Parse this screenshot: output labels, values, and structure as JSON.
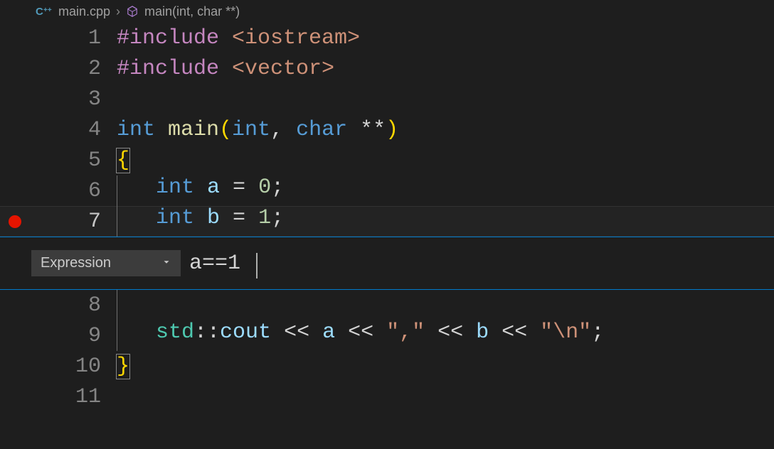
{
  "breadcrumb": {
    "file": "main.cpp",
    "symbol": "main(int, char **)"
  },
  "lines": {
    "l1": {
      "no": "1"
    },
    "l2": {
      "no": "2"
    },
    "l3": {
      "no": "3"
    },
    "l4": {
      "no": "4"
    },
    "l5": {
      "no": "5"
    },
    "l6": {
      "no": "6"
    },
    "l7": {
      "no": "7"
    },
    "l8": {
      "no": "8"
    },
    "l9": {
      "no": "9"
    },
    "l10": {
      "no": "10"
    },
    "l11": {
      "no": "11"
    }
  },
  "code": {
    "l1_pp": "#include",
    "l1_inc": " <iostream>",
    "l2_pp": "#include",
    "l2_inc": " <vector>",
    "l4_kw1": "int ",
    "l4_fn": "main",
    "l4_po": "(",
    "l4_kw2": "int",
    "l4_cm": ", ",
    "l4_kw3": "char ",
    "l4_op": "**",
    "l4_pc": ")",
    "l5_br": "{",
    "l6_kw": "int ",
    "l6_var": "a",
    "l6_eq": " = ",
    "l6_num": "0",
    "l6_sc": ";",
    "l7_kw": "int ",
    "l7_var": "b",
    "l7_eq": " = ",
    "l7_num": "1",
    "l7_sc": ";",
    "l9_ns": "std",
    "l9_cc1": "::",
    "l9_co": "cout",
    "l9_s1": " << ",
    "l9_a": "a",
    "l9_s2": " << ",
    "l9_str1": "\",\"",
    "l9_s3": " << ",
    "l9_b": "b",
    "l9_s4": " << ",
    "l9_str2": "\"\\n\"",
    "l9_sc": ";",
    "l10_br": "}"
  },
  "breakpoint_widget": {
    "type_label": "Expression",
    "expression": "a==1"
  }
}
